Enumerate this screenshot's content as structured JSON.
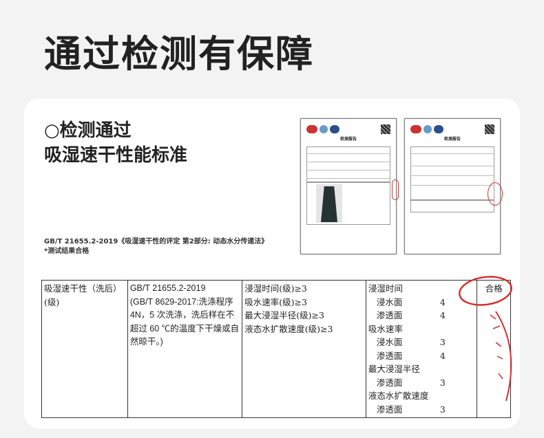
{
  "title": "通过检测有保障",
  "heading_line1": "○检测通过",
  "heading_line2": "吸湿速干性能标准",
  "note_line1": "GB/T 21655.2-2019《吸湿速干性的评定 第2部分: 动态水分传递法》",
  "note_line2": "*测试结果合格",
  "report_title": "检测报告",
  "table": {
    "item": "吸湿速干性（洗后）(级)",
    "method_line1": "GB/T  21655.2-2019",
    "method_line2": "(GB/T  8629-2017:洗涤程序 4N，5 次洗涤，洗后样在不超过 60 ℃的温度下干燥或自然晾干。)",
    "requirements": [
      "浸湿时间(级)≥3",
      "吸水速率(级)≥3",
      "最大浸湿半径(级)≥3",
      "液态水扩散速度(级)≥3"
    ],
    "results": [
      {
        "label": "浸湿时间",
        "value": ""
      },
      {
        "label": "浸水面",
        "value": "4"
      },
      {
        "label": "渗透面",
        "value": "4"
      },
      {
        "label": "吸水速率",
        "value": ""
      },
      {
        "label": "浸水面",
        "value": "3"
      },
      {
        "label": "渗透面",
        "value": "4"
      },
      {
        "label": "最大浸湿半径",
        "value": ""
      },
      {
        "label": "渗透面",
        "value": "3"
      },
      {
        "label": "液态水扩散速度",
        "value": ""
      },
      {
        "label": "渗透面",
        "value": "3"
      }
    ],
    "verdict": "合格"
  },
  "colors": {
    "stamp": "#d4302f"
  }
}
